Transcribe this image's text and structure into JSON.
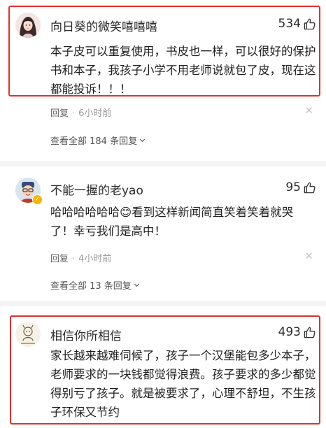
{
  "comments": [
    {
      "username": "向日葵的微笑嘻嘻嘻",
      "likes": "534",
      "text": "本子皮可以重复使用，书皮也一样，可以很好的保护书和本子，我孩子小学不用老师说就包了皮，现在这都能投诉！！！",
      "reply_label": "回复",
      "dot": "·",
      "time": "6小时前",
      "view_all": "查看全部 184 条回复"
    },
    {
      "username": "不能一握的老yao",
      "likes": "95",
      "text": "哈哈哈哈哈哈😊看到这样新闻简直笑着笑着就哭了！幸亏我们是高中！",
      "reply_label": "回复",
      "dot": "·",
      "time": "4小时前",
      "view_all": "查看全部 13 条回复"
    },
    {
      "username": "相信你所相信",
      "likes": "493",
      "text": "家长越来越难伺候了，孩子一个汉堡能包多少本子，老师要求的一块钱都觉得浪费。孩子要求的多少都觉得别亏了孩子。就是被要求了，心理不舒坦，不生孩子环保又节约"
    }
  ],
  "colors": {
    "highlight_border": "#e0312f",
    "separator": "#f4f4f4"
  },
  "icons": [
    "avatar-girl",
    "avatar-cartoon",
    "avatar-sketch",
    "thumbs-up-icon",
    "close-icon",
    "chevron-down-icon",
    "verified-badge-icon"
  ]
}
